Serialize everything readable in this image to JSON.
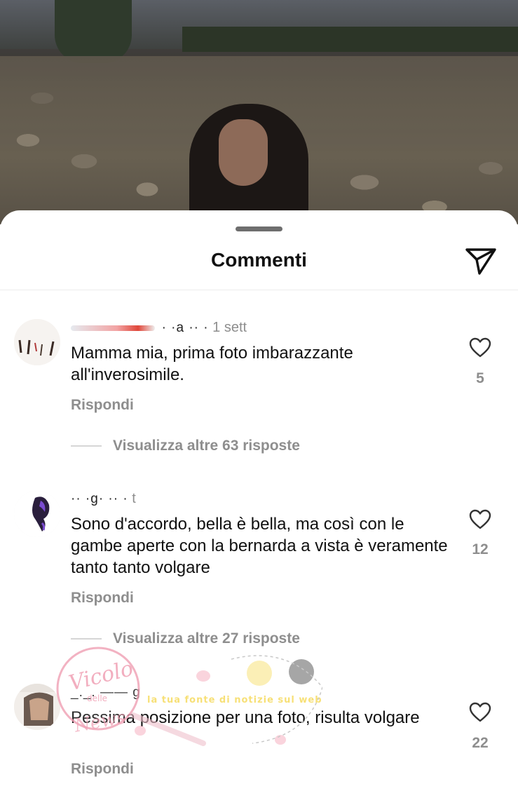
{
  "sheet": {
    "title": "Commenti",
    "send_icon": "paper-plane-icon"
  },
  "comments": [
    {
      "username": "· ·a ·· ·",
      "time": "1 sett",
      "text": "Mamma mia, prima foto imbarazzante all'inverosimile.",
      "reply_label": "Rispondi",
      "likes": "5",
      "more_replies": "Visualizza altre 63 risposte"
    },
    {
      "username": "·· ·g· ·· ·",
      "time": "t",
      "text": "Sono d'accordo, bella è bella, ma così con le gambe aperte con la bernarda a vista è veramente tanto tanto volgare",
      "reply_label": "Rispondi",
      "likes": "12",
      "more_replies": "Visualizza altre 27 risposte"
    },
    {
      "username": "_._. —— g",
      "time": "",
      "text": "Pessima posizione per una foto, risulta volgare",
      "reply_label": "Rispondi",
      "likes": "22"
    }
  ],
  "watermark": {
    "line1": "Vicolo",
    "line2": "delle",
    "line3": "News",
    "banner": "la tua fonte di notizie sul web"
  },
  "colors": {
    "accent_text": "#111111",
    "secondary_text": "#8e8e8e"
  }
}
